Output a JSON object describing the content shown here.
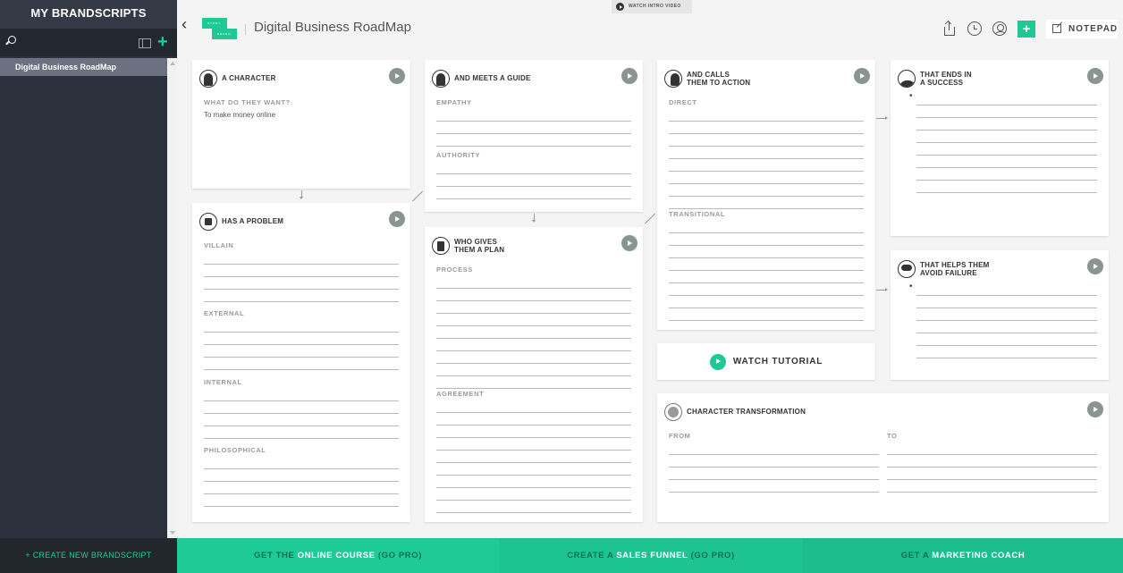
{
  "sidebar": {
    "title": "MY BRANDSCRIPTS",
    "items": [
      {
        "label": "Digital Business RoadMap",
        "selected": true
      }
    ],
    "create_label": "+ CREATE NEW BRANDSCRIPT"
  },
  "topbar": {
    "intro_video": "WATCH INTRO VIDEO",
    "logo_top": "STORY",
    "logo_bottom": "BRAND",
    "title": "Digital Business RoadMap",
    "add_label": "+",
    "notepad_label": "NOTEPAD"
  },
  "cards": {
    "character": {
      "title": "A CHARACTER",
      "sections": [
        {
          "label": "WHAT DO THEY WANT?",
          "value": "To make money online"
        }
      ]
    },
    "problem": {
      "title": "HAS A PROBLEM",
      "sections": [
        {
          "label": "VILLAIN"
        },
        {
          "label": "EXTERNAL"
        },
        {
          "label": "INTERNAL"
        },
        {
          "label": "PHILOSOPHICAL"
        }
      ]
    },
    "guide": {
      "title": "AND MEETS A GUIDE",
      "sections": [
        {
          "label": "EMPATHY"
        },
        {
          "label": "AUTHORITY"
        }
      ]
    },
    "plan": {
      "title_1": "WHO GIVES",
      "title_2": "THEM A PLAN",
      "sections": [
        {
          "label": "PROCESS"
        },
        {
          "label": "AGREEMENT"
        }
      ]
    },
    "action": {
      "title_1": "AND CALLS",
      "title_2": "THEM TO ACTION",
      "sections": [
        {
          "label": "DIRECT"
        },
        {
          "label": "TRANSITIONAL"
        }
      ]
    },
    "success": {
      "title_1": "THAT ENDS IN",
      "title_2": "A SUCCESS",
      "bullet": "•"
    },
    "failure": {
      "title_1": "THAT HELPS THEM",
      "title_2": "AVOID FAILURE",
      "bullet": "•"
    },
    "transformation": {
      "title": "CHARACTER TRANSFORMATION",
      "from_label": "FROM",
      "to_label": "TO"
    }
  },
  "tutorial": {
    "label": "WATCH TUTORIAL"
  },
  "footer": {
    "online_course": {
      "pre": "GET THE ",
      "bold": "ONLINE COURSE",
      "post": " (GO PRO)"
    },
    "sales_funnel": {
      "pre": "CREATE A ",
      "bold": "SALES FUNNEL",
      "post": " (GO PRO)"
    },
    "marketing_coach": {
      "pre": "GET A ",
      "bold": "MARKETING COACH",
      "post": ""
    }
  },
  "colors": {
    "accent": "#1fc996",
    "sidebar_bg": "#2b313c",
    "selected_item": "#6b7180"
  }
}
